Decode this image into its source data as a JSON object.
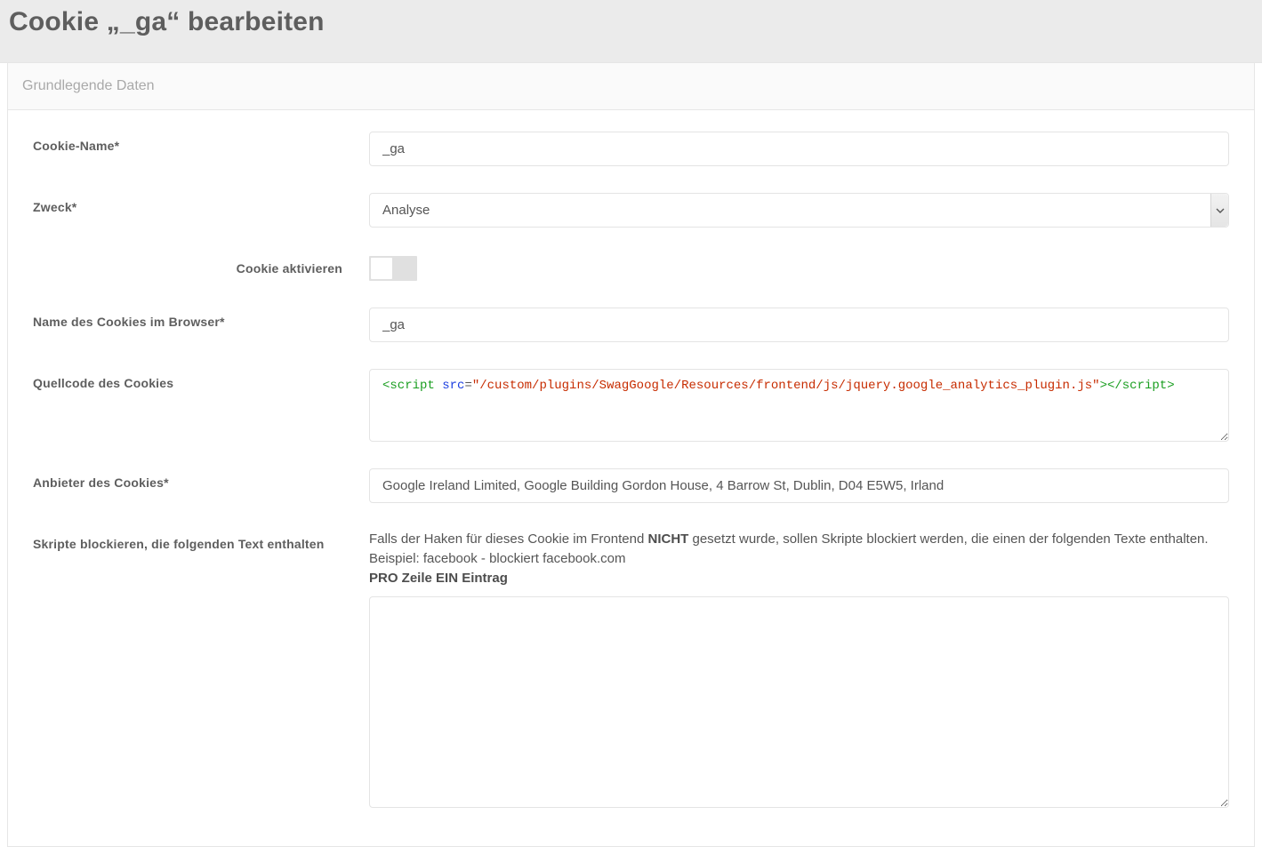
{
  "header": {
    "title": "Cookie „_ga“ bearbeiten"
  },
  "section": {
    "title": "Grundlegende Daten"
  },
  "labels": {
    "cookie_name": "Cookie-Name*",
    "purpose": "Zweck*",
    "activate": "Cookie aktivieren",
    "browser_name": "Name des Cookies im Browser*",
    "source": "Quellcode des Cookies",
    "provider": "Anbieter des Cookies*",
    "blockscripts": "Skripte blockieren, die folgenden Text enthalten"
  },
  "values": {
    "cookie_name": "_ga",
    "purpose": "Analyse",
    "browser_name": "_ga",
    "provider": "Google Ireland Limited, Google Building Gordon House, 4 Barrow St, Dublin, D04 E5W5, Irland",
    "blockscripts": ""
  },
  "source_code": {
    "open_tag": "<script ",
    "attr": "src",
    "eq": "=",
    "val": "\"/custom/plugins/SwagGoogle/Resources/frontend/js/jquery.google_analytics_plugin.js\"",
    "close": "></scr",
    "close2": "ipt>"
  },
  "help": {
    "p1a": "Falls der Haken für dieses Cookie im Frontend ",
    "p1b": "NICHT",
    "p1c": " gesetzt wurde, sollen Skripte blockiert werden, die einen der folgenden Texte enthalten. Beispiel: facebook - blockiert facebook.com",
    "p2": "PRO Zeile EIN Eintrag"
  }
}
